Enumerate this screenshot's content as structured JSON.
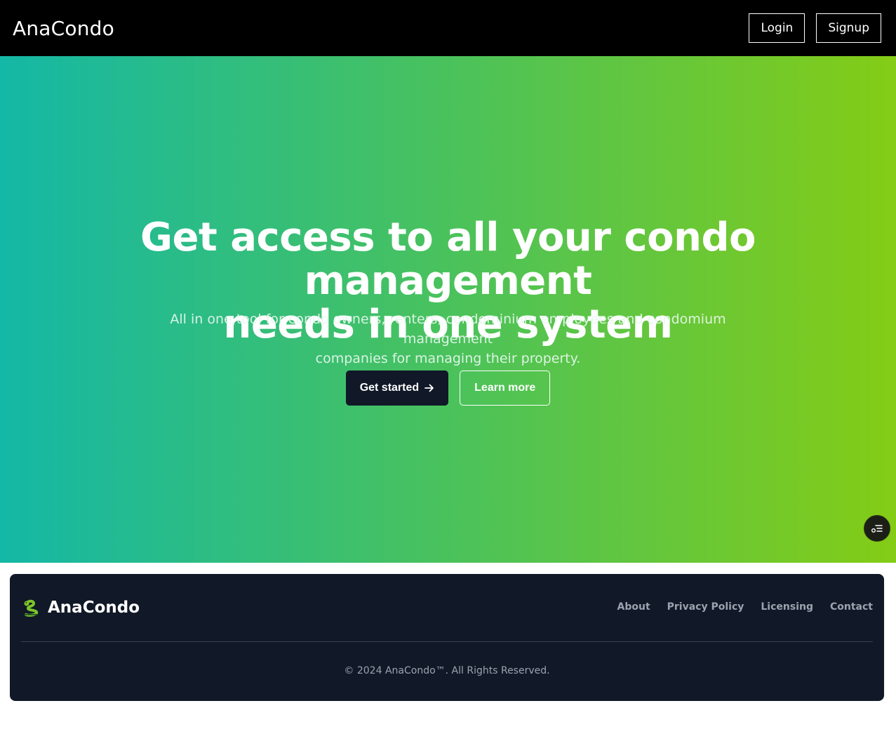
{
  "header": {
    "brand": "AnaCondo",
    "login_label": "Login",
    "signup_label": "Signup"
  },
  "hero": {
    "title_line1": "Get access to all your condo management",
    "title_line2": "needs in one system",
    "subtitle_line1": "All in one tool for condo owners, renters, condominium employees and condomium management",
    "subtitle_line2": "companies for managing their property.",
    "get_started_label": "Get started",
    "learn_more_label": "Learn more"
  },
  "footer": {
    "brand": "AnaCondo",
    "links": [
      "About",
      "Privacy Policy",
      "Licensing",
      "Contact"
    ],
    "copyright": "© 2024 AnaCondo™. All Rights Reserved."
  },
  "icons": {
    "arrow": "arrow-right-icon",
    "floating": "list-settings-icon",
    "logo": "snake-icon"
  },
  "colors": {
    "gradient_start": "#14b8a6",
    "gradient_end": "#84cc16",
    "dark": "#111827",
    "header_bg": "#000000"
  }
}
